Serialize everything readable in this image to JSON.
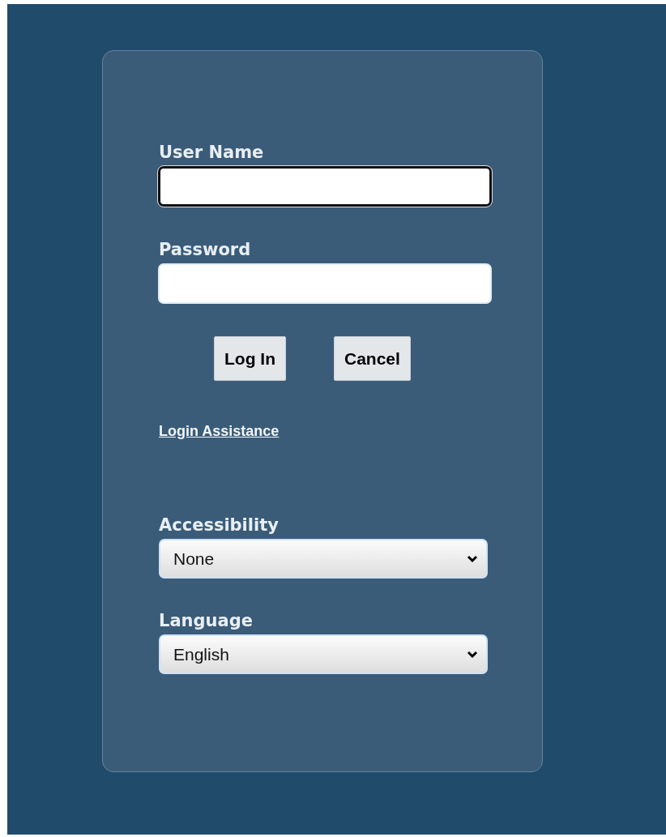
{
  "fields": [
    {
      "label": "User Name",
      "focused": true
    },
    {
      "label": "Password",
      "focused": false
    }
  ],
  "buttons": [
    "Log In",
    "Cancel"
  ],
  "link": "Login Assistance",
  "selects": [
    {
      "label": "Accessibility",
      "value": "None"
    },
    {
      "label": "Language",
      "value": "English"
    }
  ]
}
